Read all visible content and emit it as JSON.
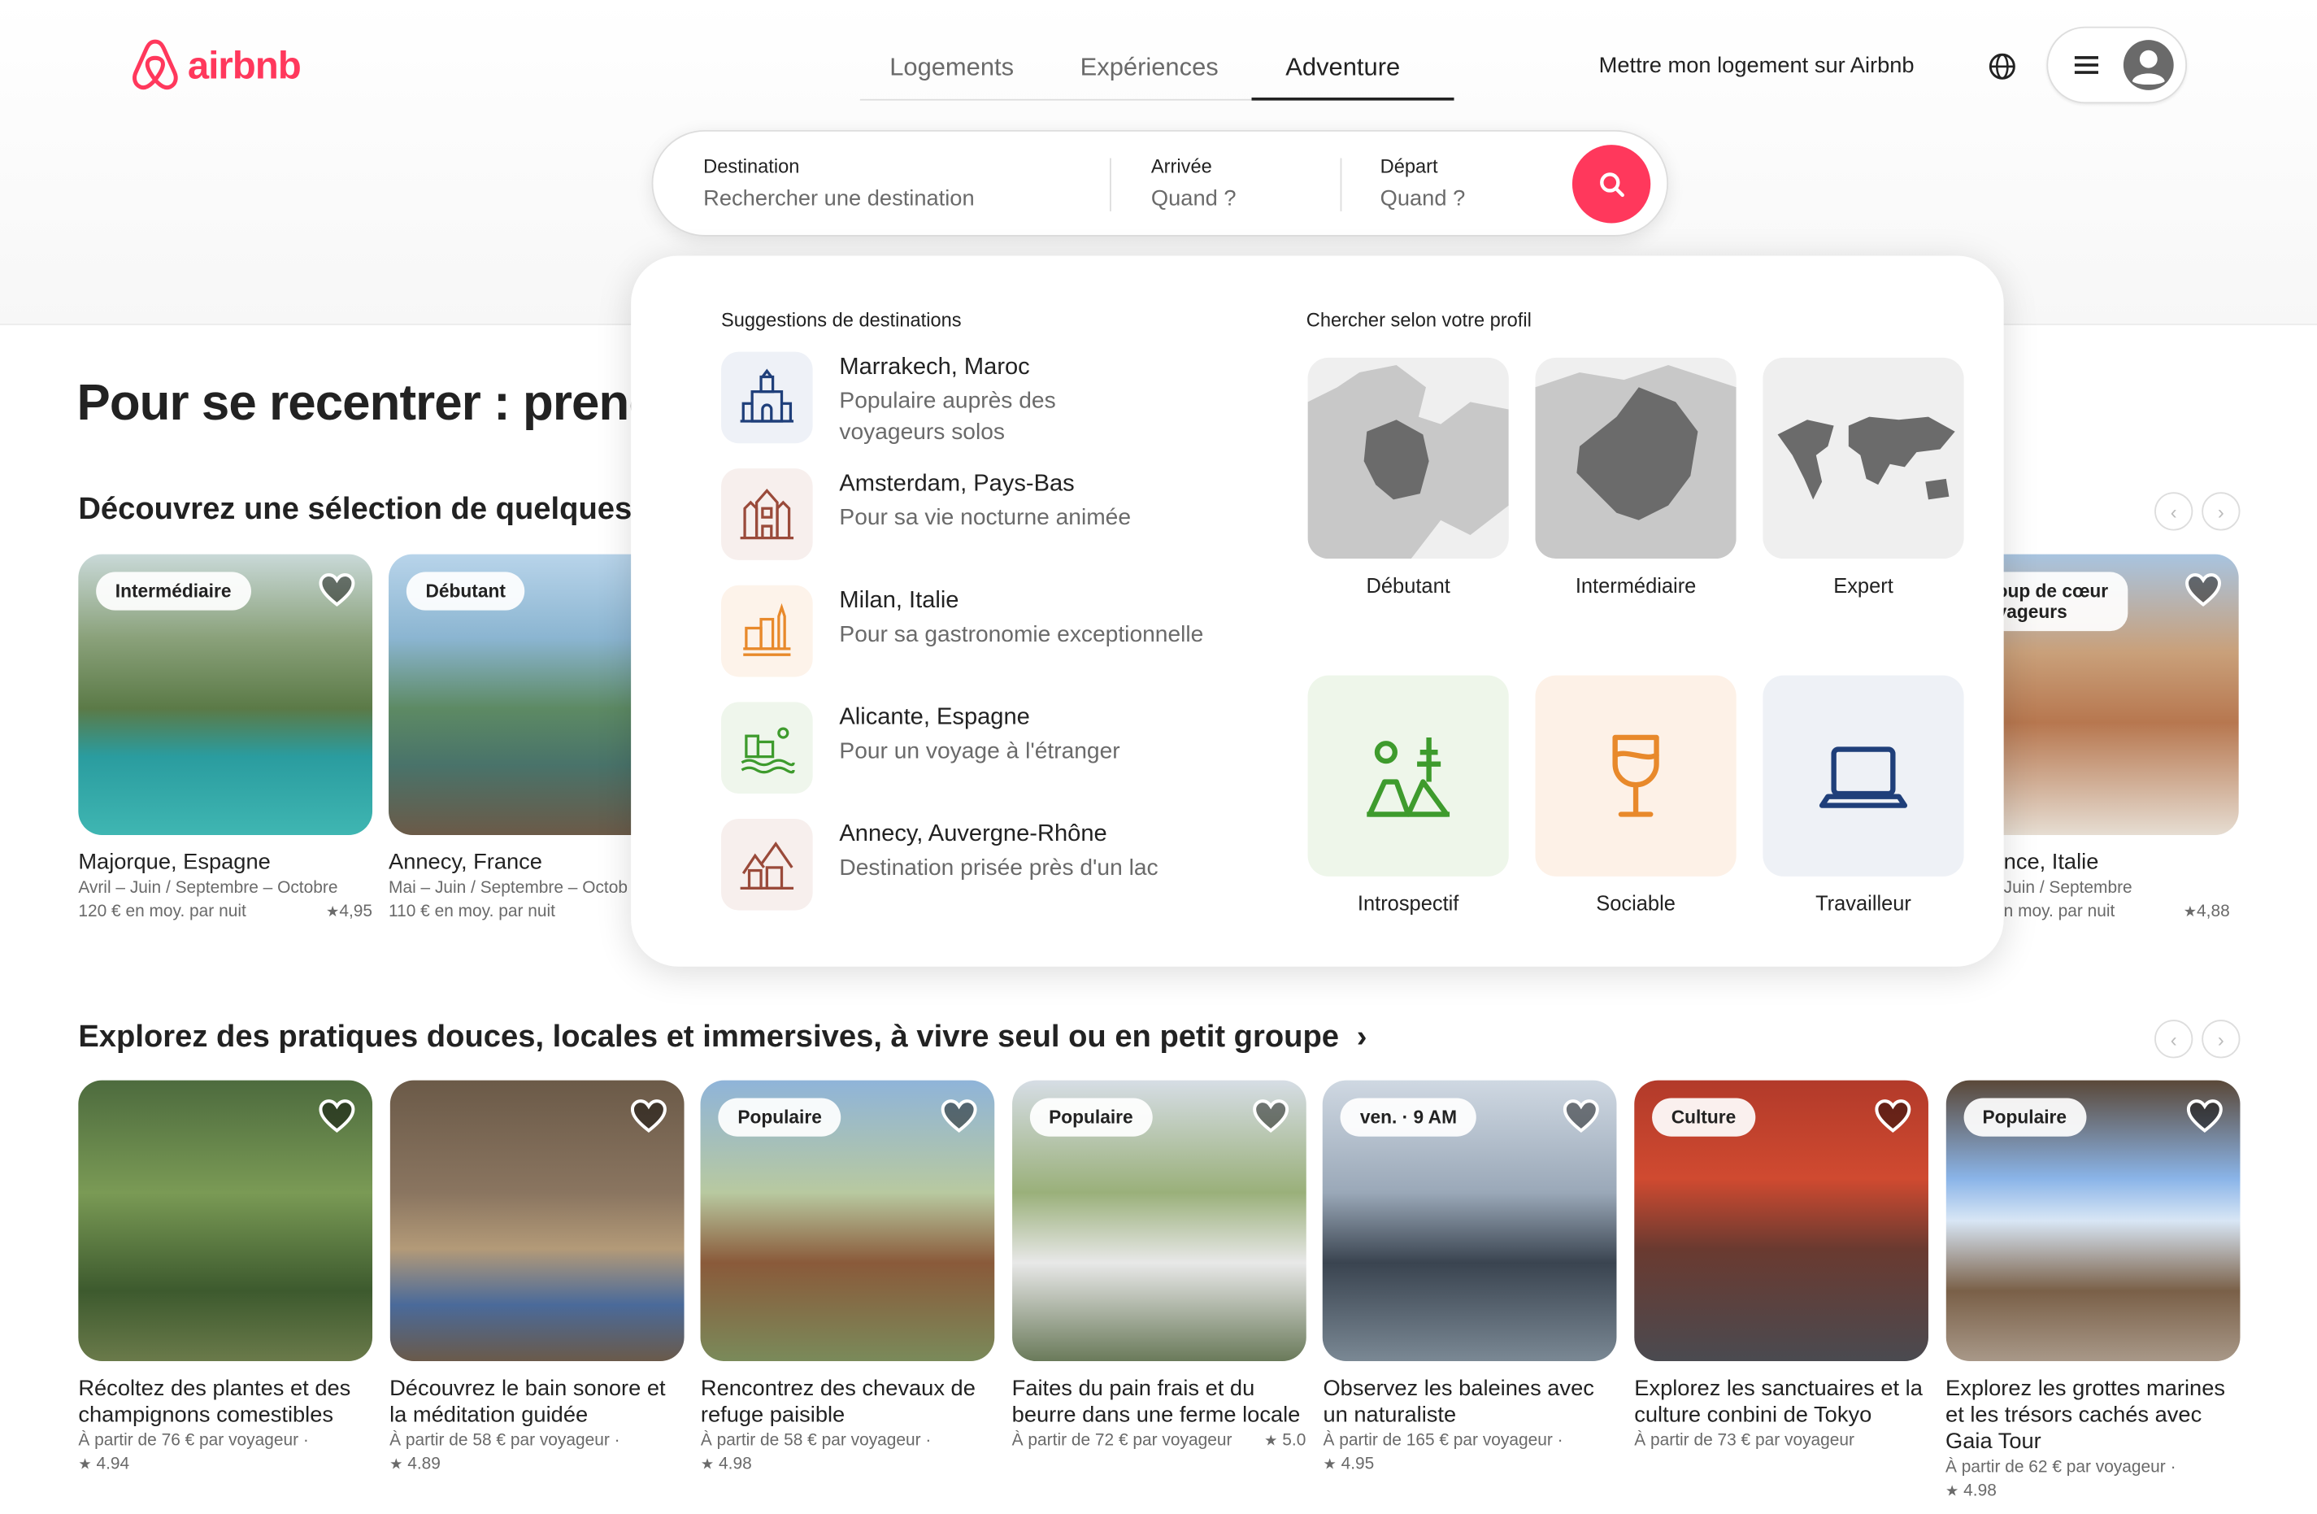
{
  "brand": {
    "name": "airbnb",
    "color": "#ff385c"
  },
  "nav": {
    "tabs": [
      {
        "label": "Logements",
        "active": false
      },
      {
        "label": "Expériences",
        "active": false
      },
      {
        "label": "Adventure",
        "active": true
      }
    ],
    "host_link": "Mettre mon logement sur Airbnb"
  },
  "search": {
    "destination": {
      "label": "Destination",
      "placeholder": "Rechercher une destination"
    },
    "arrival": {
      "label": "Arrivée",
      "placeholder": "Quand ?"
    },
    "departure": {
      "label": "Départ",
      "placeholder": "Quand ?"
    }
  },
  "hero_title": "Pour se recentrer : prene",
  "section1": {
    "title": "Découvrez une sélection de quelques",
    "cards": [
      {
        "badge": "Intermédiaire",
        "title": "Majorque, Espagne",
        "dates": "Avril – Juin / Septembre – Octobre",
        "price": "120 € en moy. par nuit",
        "rating": "4,95"
      },
      {
        "badge": "Débutant",
        "title": "Annecy, France",
        "dates": "Mai – Juin / Septembre – Octob",
        "price": "110 € en moy. par nuit",
        "rating": ""
      },
      {
        "badge": "oup de cœur\nyageurs",
        "title": "nce, Italie",
        "dates": "Juin / Septembre",
        "price": "n moy. par nuit",
        "rating": "4,88"
      }
    ]
  },
  "dropdown": {
    "suggestions_header": "Suggestions de destinations",
    "profile_header": "Chercher selon votre profil",
    "suggestions": [
      {
        "name": "Marrakech, Maroc",
        "desc": "Populaire auprès des voyageurs solos",
        "icon": "mosque-icon"
      },
      {
        "name": "Amsterdam, Pays-Bas",
        "desc": "Pour sa vie nocturne animée",
        "icon": "canal-houses-icon"
      },
      {
        "name": "Milan, Italie",
        "desc": "Pour sa gastronomie exceptionnelle",
        "icon": "city-skyline-icon"
      },
      {
        "name": "Alicante, Espagne",
        "desc": "Pour un voyage à l'étranger",
        "icon": "beach-city-icon"
      },
      {
        "name": "Annecy, Auvergne-Rhône",
        "desc": "Destination prisée près d'un lac",
        "icon": "mountain-town-icon"
      }
    ],
    "levels": [
      {
        "label": "Débutant",
        "icon": "france-map-icon"
      },
      {
        "label": "Intermédiaire",
        "icon": "europe-map-icon"
      },
      {
        "label": "Expert",
        "icon": "world-map-icon"
      }
    ],
    "profiles": [
      {
        "label": "Introspectif",
        "icon": "meditation-icon",
        "color": "#3e9b2d"
      },
      {
        "label": "Sociable",
        "icon": "wine-glass-icon",
        "color": "#e8892b"
      },
      {
        "label": "Travailleur",
        "icon": "laptop-icon",
        "color": "#1f3f7a"
      }
    ]
  },
  "section2": {
    "title": "Explorez des pratiques douces, locales et immersives, à vivre seul ou en petit groupe",
    "cards": [
      {
        "badge": "",
        "title": "Récoltez des plantes et des champignons comestibles",
        "price": "À partir de 76 € par voyageur ·",
        "rating": "4.94"
      },
      {
        "badge": "",
        "title": "Découvrez le bain sonore et la méditation guidée",
        "price": "À partir de 58 € par voyageur ·",
        "rating": "4.89"
      },
      {
        "badge": "Populaire",
        "title": "Rencontrez des chevaux de refuge paisible",
        "price": "À partir de 58 € par voyageur ·",
        "rating": "4.98"
      },
      {
        "badge": "Populaire",
        "title": "Faites du pain frais et du beurre dans une ferme locale",
        "price": "À partir de 72 € par voyageur",
        "rating": "5.0"
      },
      {
        "badge": "ven. · 9 AM",
        "title": "Observez les baleines avec un naturaliste",
        "price": "À partir de 165 € par voyageur ·",
        "rating": "4.95"
      },
      {
        "badge": "Culture",
        "title": "Explorez les sanctuaires et la culture conbini de Tokyo",
        "price": "À partir de 73 € par voyageur",
        "rating": ""
      },
      {
        "badge": "Populaire",
        "title": "Explorez les grottes marines et les trésors cachés avec Gaia Tour",
        "price": "À partir de 62 € par voyageur ·",
        "rating": "4.98"
      }
    ]
  }
}
